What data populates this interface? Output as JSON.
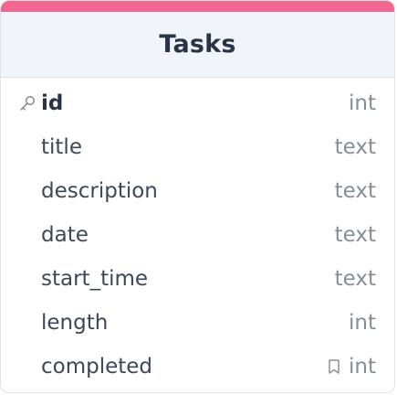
{
  "table": {
    "name": "Tasks",
    "accent_color": "#f2668f",
    "fields": [
      {
        "name": "id",
        "type": "int",
        "primary_key": true,
        "icon": "key-icon"
      },
      {
        "name": "title",
        "type": "text"
      },
      {
        "name": "description",
        "type": "text"
      },
      {
        "name": "date",
        "type": "text"
      },
      {
        "name": "start_time",
        "type": "text"
      },
      {
        "name": "length",
        "type": "int"
      },
      {
        "name": "completed",
        "type": "int",
        "icon": "bookmark-icon"
      }
    ]
  }
}
